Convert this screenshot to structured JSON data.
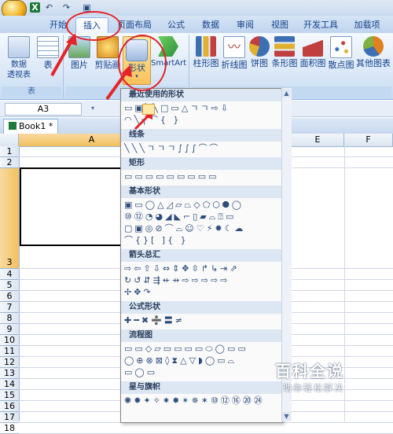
{
  "qat": {
    "icons": [
      "office-logo",
      "excel-icon",
      "undo-icon",
      "redo-icon",
      "save-icon"
    ]
  },
  "tabs": [
    "开始",
    "插入",
    "页面布局",
    "公式",
    "数据",
    "审阅",
    "视图",
    "开发工具",
    "加载项"
  ],
  "ribbon": {
    "pivot_label": "数据\n透视表",
    "table_label": "表",
    "tables_group": "表",
    "picture_label": "图片",
    "clipart_label": "剪贴画",
    "shapes_label": "形状",
    "smartart_label": "SmartArt",
    "column_label": "柱形图",
    "line_label": "折线图",
    "pie_label": "饼图",
    "bar_label": "条形图",
    "area_label": "面积图",
    "scatter_label": "散点图",
    "other_label": "其他图表"
  },
  "name_box": "A3",
  "book_tab": "Book1 *",
  "columns": [
    "A",
    "E",
    "F"
  ],
  "rows": [
    "1",
    "2",
    "3",
    "4",
    "5",
    "6",
    "7",
    "8",
    "9",
    "10",
    "11",
    "12",
    "13",
    "14",
    "15",
    "16",
    "17",
    "18"
  ],
  "menu": {
    "sections": [
      {
        "title": "最近使用的形状",
        "rows": [
          "▭▣╲╲□▭△ㄱㄱ⇨⇩",
          "◠╲╮⌒{ }"
        ]
      },
      {
        "title": "线条",
        "rows": [
          "╲╲╲ㄱㄱㄱ∫∫∫⌒⌒"
        ]
      },
      {
        "title": "矩形",
        "rows": [
          "▭▭▭▭▭▭▭▭▭"
        ]
      },
      {
        "title": "基本形状",
        "rows": [
          "▣▭◯△◿▱⏢◇⬠⬡⯃◯",
          "⑩⑫◔◕◢◣⌐▯▰⌓⍰▭",
          "▢▣◎⊘⌒⌓☺♡⚡✹☾☁",
          "⌒{}[ ]{ }"
        ]
      },
      {
        "title": "箭头总汇",
        "rows": [
          "⇨⇦⇧⇩⇔⇕✥⇳↱↳⇥⇗",
          "↻↺⇵⇶⇷⇸⇨⇨⇨⇨⇨",
          "✢✥↷"
        ]
      },
      {
        "title": "公式形状",
        "rows": [
          "✚━✖➗〓≠"
        ]
      },
      {
        "title": "流程图",
        "rows": [
          "▭▭◇▱▭▭▭▭⬭◯▭▭",
          "◯⊕⊗⊠◊⧗△▽◗◯▭⌓",
          "▭◯▭"
        ]
      },
      {
        "title": "星与旗帜",
        "rows": [
          "✺✹✦✧✷✸✴✵✶⑩⑫⑯⑳㉔"
        ]
      }
    ]
  },
  "watermark": {
    "title": "百科全说",
    "subtitle": "助你轻松解决"
  }
}
